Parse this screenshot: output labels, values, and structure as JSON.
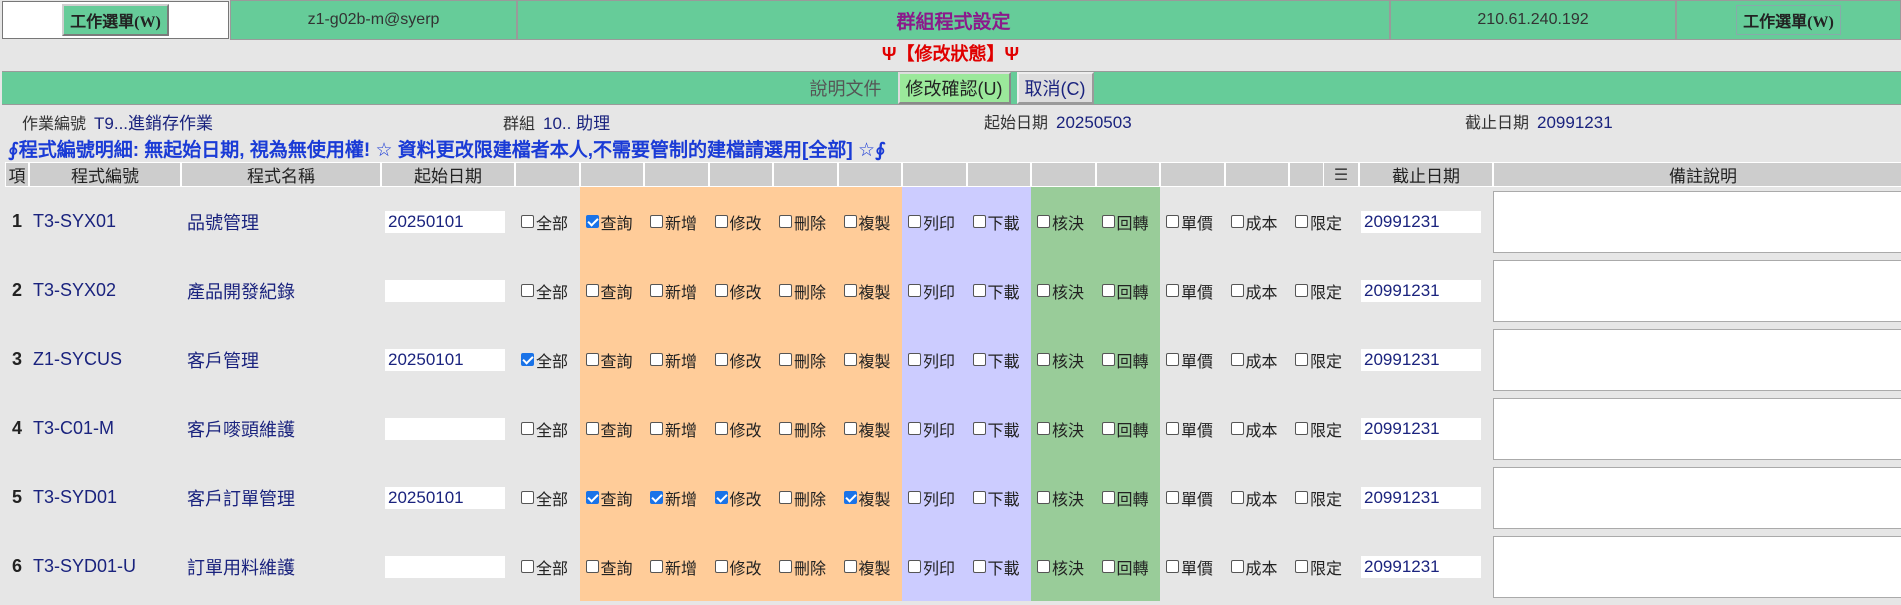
{
  "topbar": {
    "menu_left": "工作選單(W)",
    "user": "z1-g02b-m@syerp",
    "title": "群組程式設定",
    "ip": "210.61.240.192",
    "menu_right": "工作選單(W)"
  },
  "status": "Ψ【修改狀態】Ψ",
  "actions": {
    "doc": "說明文件",
    "confirm": "修改確認(U)",
    "cancel": "取消(C)"
  },
  "info": {
    "job_label": "作業編號",
    "job_value": "T9...進銷存作業",
    "group_label": "群組",
    "group_value": "10.. 助理",
    "start_label": "起始日期",
    "start_value": "20250503",
    "end_label": "截止日期",
    "end_value": "20991231"
  },
  "notice": "∮程式編號明細: 無起始日期, 視為無使用權! ☆ 資料更改限建檔者本人,不需要管制的建檔請選用[全部] ☆∮",
  "headers": {
    "num": "項",
    "code": "程式編號",
    "name": "程式名稱",
    "start": "起始日期",
    "end": "截止日期",
    "remark": "備註說明"
  },
  "perm_labels": [
    "全部",
    "查詢",
    "新增",
    "修改",
    "刪除",
    "複製",
    "列印",
    "下載",
    "核決",
    "回轉",
    "單價",
    "成本",
    "限定"
  ],
  "rows": [
    {
      "num": "1",
      "code": "T3-SYX01",
      "name": "品號管理",
      "start": "20250101",
      "end": "20991231",
      "checks": [
        false,
        true,
        false,
        false,
        false,
        false,
        false,
        false,
        false,
        false,
        false,
        false,
        false
      ]
    },
    {
      "num": "2",
      "code": "T3-SYX02",
      "name": "產品開發紀錄",
      "start": "",
      "end": "20991231",
      "checks": [
        false,
        false,
        false,
        false,
        false,
        false,
        false,
        false,
        false,
        false,
        false,
        false,
        false
      ]
    },
    {
      "num": "3",
      "code": "Z1-SYCUS",
      "name": "客戶管理",
      "start": "20250101",
      "end": "20991231",
      "checks": [
        true,
        false,
        false,
        false,
        false,
        false,
        false,
        false,
        false,
        false,
        false,
        false,
        false
      ]
    },
    {
      "num": "4",
      "code": "T3-C01-M",
      "name": "客戶嘜頭維護",
      "start": "",
      "end": "20991231",
      "checks": [
        false,
        false,
        false,
        false,
        false,
        false,
        false,
        false,
        false,
        false,
        false,
        false,
        false
      ]
    },
    {
      "num": "5",
      "code": "T3-SYD01",
      "name": "客戶訂單管理",
      "start": "20250101",
      "end": "20991231",
      "checks": [
        false,
        true,
        true,
        true,
        false,
        true,
        false,
        false,
        false,
        false,
        false,
        false,
        false
      ]
    },
    {
      "num": "6",
      "code": "T3-SYD01-U",
      "name": "訂單用料維護",
      "start": "",
      "end": "20991231",
      "checks": [
        false,
        false,
        false,
        false,
        false,
        false,
        false,
        false,
        false,
        false,
        false,
        false,
        false
      ]
    }
  ],
  "colors": {
    "header_green": "#66cc99",
    "title_purple": "#8b1a8b",
    "status_red": "#e00000",
    "notice_blue": "#1a3bd6",
    "perm_orange": "#ffcc99",
    "perm_purple": "#ccccff",
    "perm_green": "#99cc99"
  }
}
